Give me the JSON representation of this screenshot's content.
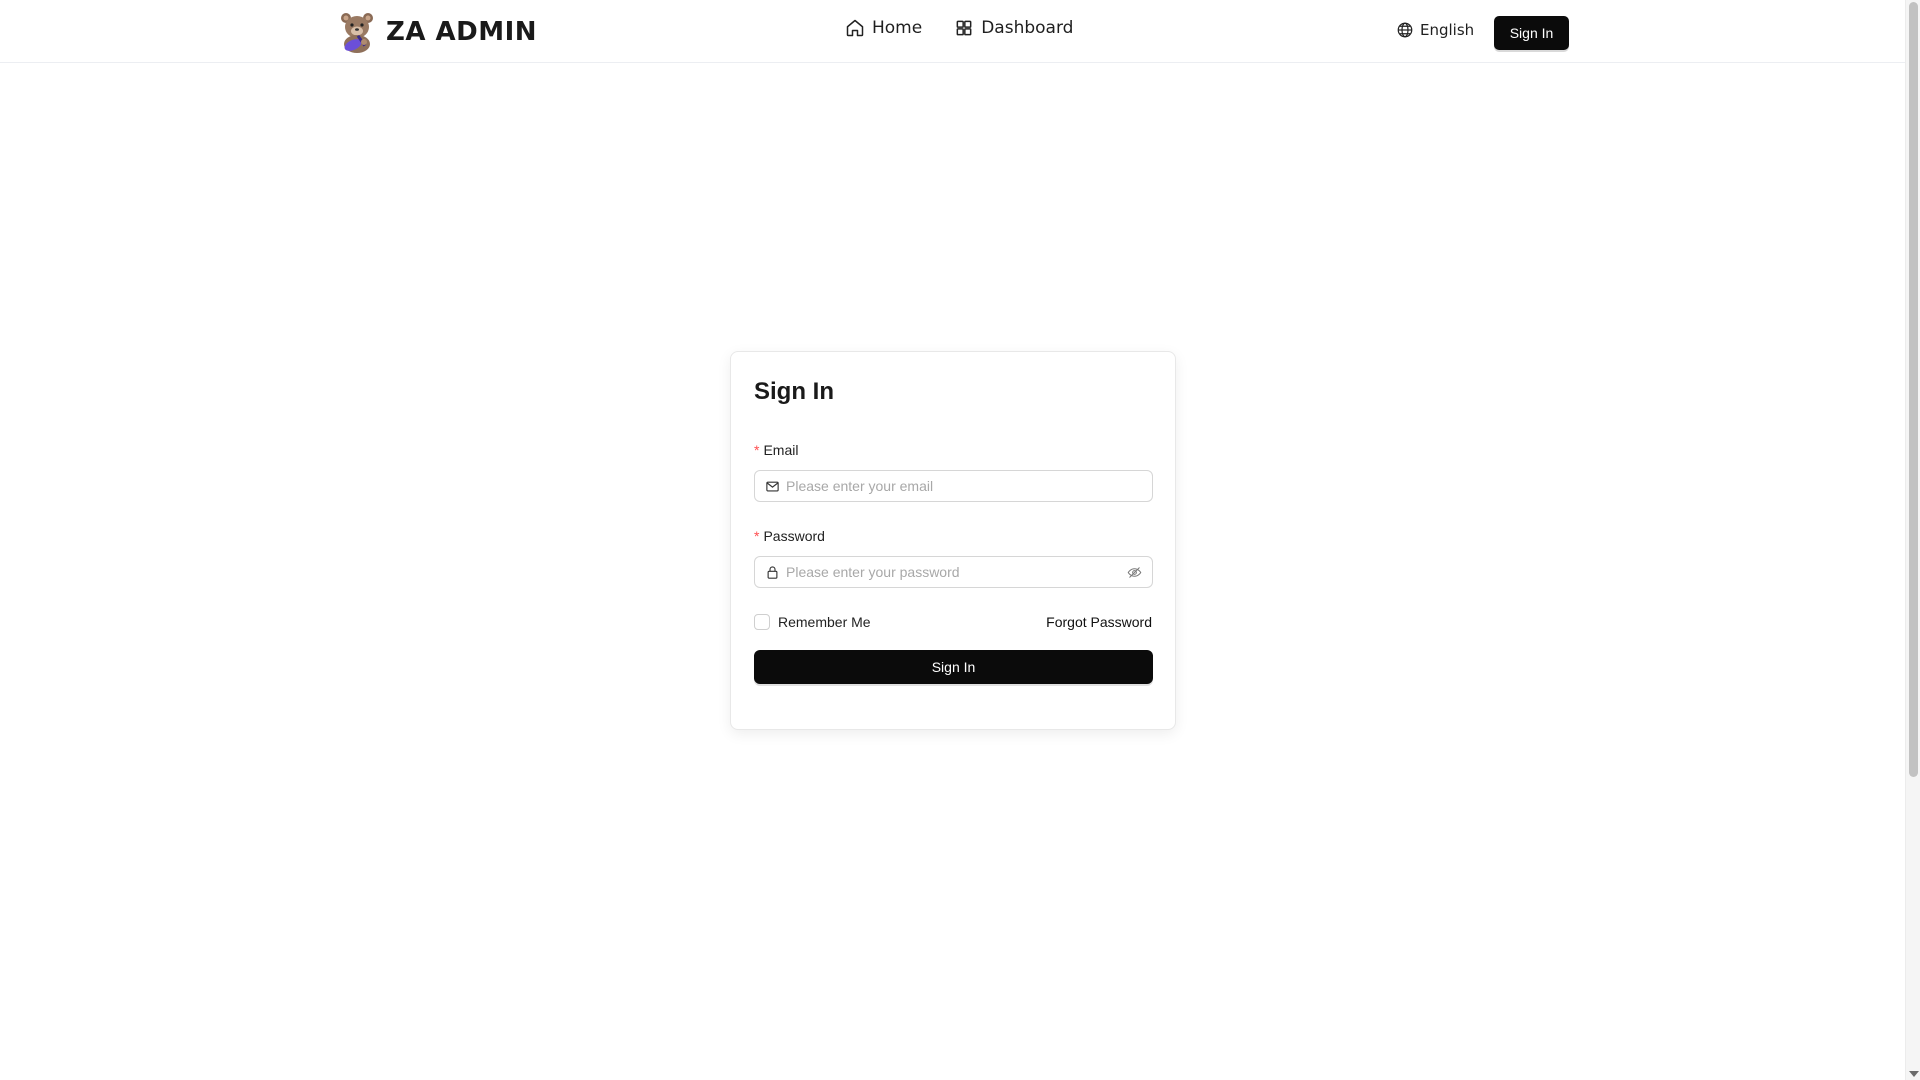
{
  "header": {
    "brand_name": "ZA ADMIN",
    "logo_icon": "bear-mascot-icon",
    "nav": [
      {
        "label": "Home",
        "icon": "home-icon"
      },
      {
        "label": "Dashboard",
        "icon": "grid-icon"
      }
    ],
    "language": {
      "label": "English",
      "icon": "globe-icon"
    },
    "signin_label": "Sign In"
  },
  "login": {
    "title": "Sign In",
    "email": {
      "label": "Email",
      "required_mark": "*",
      "placeholder": "Please enter your email",
      "icon": "mail-icon"
    },
    "password": {
      "label": "Password",
      "required_mark": "*",
      "placeholder": "Please enter your password",
      "icon": "lock-icon",
      "toggle_icon": "eye-off-icon"
    },
    "remember_label": "Remember Me",
    "remember_checked": false,
    "forgot_label": "Forgot Password",
    "submit_label": "Sign In"
  },
  "colors": {
    "primary": "#0b0b0b",
    "required": "#ff4d4f",
    "placeholder": "#a8a8a8"
  }
}
